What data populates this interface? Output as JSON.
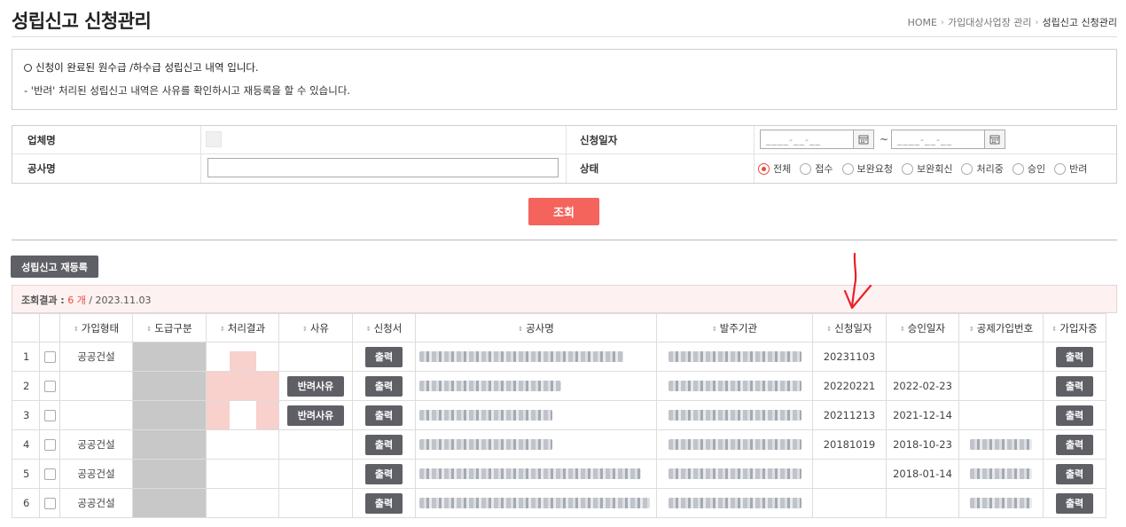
{
  "page": {
    "title": "성립신고 신청관리",
    "breadcrumb": [
      "HOME",
      "가입대상사업장 관리",
      "성립신고 신청관리"
    ]
  },
  "notice": {
    "line1": "신청이 완료된 원수급 /하수급 성립신고 내역 입니다.",
    "line2": "- '반려' 처리된 성립신고 내역은 사유를 확인하시고 재등록을 할 수 있습니다."
  },
  "search": {
    "company_label": "업체명",
    "project_label": "공사명",
    "date_label": "신청일자",
    "status_label": "상태",
    "date_from_placeholder": "____-__-__",
    "date_to_placeholder": "____-__-__",
    "tilde": "~",
    "status_options": [
      "전체",
      "접수",
      "보완요청",
      "보완회신",
      "처리중",
      "승인",
      "반려"
    ],
    "status_selected": "전체",
    "submit_label": "조회"
  },
  "actions": {
    "reregister_label": "성립신고 재등록"
  },
  "result": {
    "label": "조회결과 :",
    "count": "6 개",
    "date": "/ 2023.11.03"
  },
  "table": {
    "columns": [
      "",
      "",
      "가입형태",
      "도급구분",
      "처리결과",
      "사유",
      "신청서",
      "공사명",
      "발주기관",
      "신청일자",
      "승인일자",
      "공제가입번호",
      "가입자증"
    ],
    "print_label": "출력",
    "reject_label": "반려사유",
    "rows": [
      {
        "no": "1",
        "type": "공공건설",
        "has_reason": false,
        "apply_date": "20231103",
        "approve_date": "",
        "has_member_no": false
      },
      {
        "no": "2",
        "type": "",
        "has_reason": true,
        "apply_date": "20220221",
        "approve_date": "2022-02-23",
        "has_member_no": false
      },
      {
        "no": "3",
        "type": "",
        "has_reason": true,
        "apply_date": "20211213",
        "approve_date": "2021-12-14",
        "has_member_no": false
      },
      {
        "no": "4",
        "type": "공공건설",
        "has_reason": false,
        "apply_date": "20181019",
        "approve_date": "2018-10-23",
        "has_member_no": true
      },
      {
        "no": "5",
        "type": "공공건설",
        "has_reason": false,
        "apply_date": "",
        "approve_date": "2018-01-14",
        "has_member_no": true
      },
      {
        "no": "6",
        "type": "공공건설",
        "has_reason": false,
        "apply_date": "",
        "approve_date": "",
        "has_member_no": true
      }
    ]
  },
  "colors": {
    "accent": "#f4645c",
    "dark_button": "#5f5f66",
    "result_bg": "#fdf1f1",
    "count_red": "#e74c3c"
  }
}
